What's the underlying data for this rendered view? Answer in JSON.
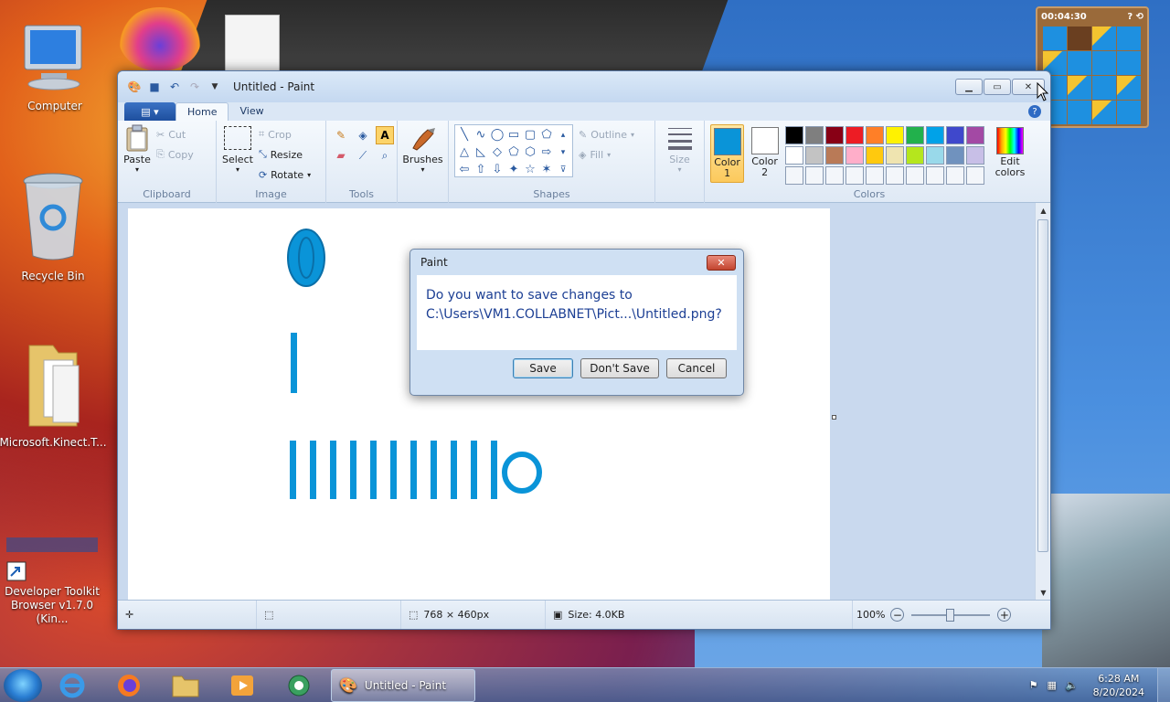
{
  "desktop": {
    "icons": [
      {
        "label": "Computer"
      },
      {
        "label": "Recycle Bin"
      },
      {
        "label": "Microsoft.Kinect.T..."
      },
      {
        "label": "Developer Toolkit Browser v1.7.0 (Kin..."
      }
    ]
  },
  "puzzle": {
    "timer": "00:04:30"
  },
  "window": {
    "title": "Untitled - Paint",
    "tabs": [
      "Home",
      "View"
    ],
    "ribbon": {
      "clipboard": {
        "paste": "Paste",
        "cut": "Cut",
        "copy": "Copy",
        "label": "Clipboard"
      },
      "image": {
        "select": "Select",
        "crop": "Crop",
        "resize": "Resize",
        "rotate": "Rotate",
        "label": "Image"
      },
      "tools": {
        "label": "Tools"
      },
      "brushes": {
        "label": "Brushes"
      },
      "shapes": {
        "outline": "Outline",
        "fill": "Fill",
        "label": "Shapes"
      },
      "size": {
        "label": "Size"
      },
      "colors": {
        "color1": "Color 1",
        "color2": "Color 2",
        "edit": "Edit colors",
        "label": "Colors",
        "color1_value": "#0a94d8",
        "color2_value": "#ffffff",
        "palette": [
          "#000000",
          "#7f7f7f",
          "#880015",
          "#ed1c24",
          "#ff7f27",
          "#fff200",
          "#22b14c",
          "#00a2e8",
          "#3f48cc",
          "#a349a4",
          "#ffffff",
          "#c3c3c3",
          "#b97a57",
          "#ffaec9",
          "#ffc90e",
          "#efe4b0",
          "#b5e61d",
          "#99d9ea",
          "#7092be",
          "#c8bfe7",
          "#f3f6fa",
          "#f3f6fa",
          "#f3f6fa",
          "#f3f6fa",
          "#f3f6fa",
          "#f3f6fa",
          "#f3f6fa",
          "#f3f6fa",
          "#f3f6fa",
          "#f3f6fa"
        ]
      }
    },
    "canvas": {
      "ink_color": "#0a94d8"
    },
    "status": {
      "dimensions": "768 × 460px",
      "size": "Size: 4.0KB",
      "zoom": "100%"
    }
  },
  "dialog": {
    "title": "Paint",
    "message_line1": "Do you want to save changes to",
    "message_line2": "C:\\Users\\VM1.COLLABNET\\Pict...\\Untitled.png?",
    "save": "Save",
    "dont_save": "Don't Save",
    "cancel": "Cancel"
  },
  "taskbar": {
    "active_task": "Untitled - Paint",
    "time": "6:28 AM",
    "date": "8/20/2024"
  }
}
